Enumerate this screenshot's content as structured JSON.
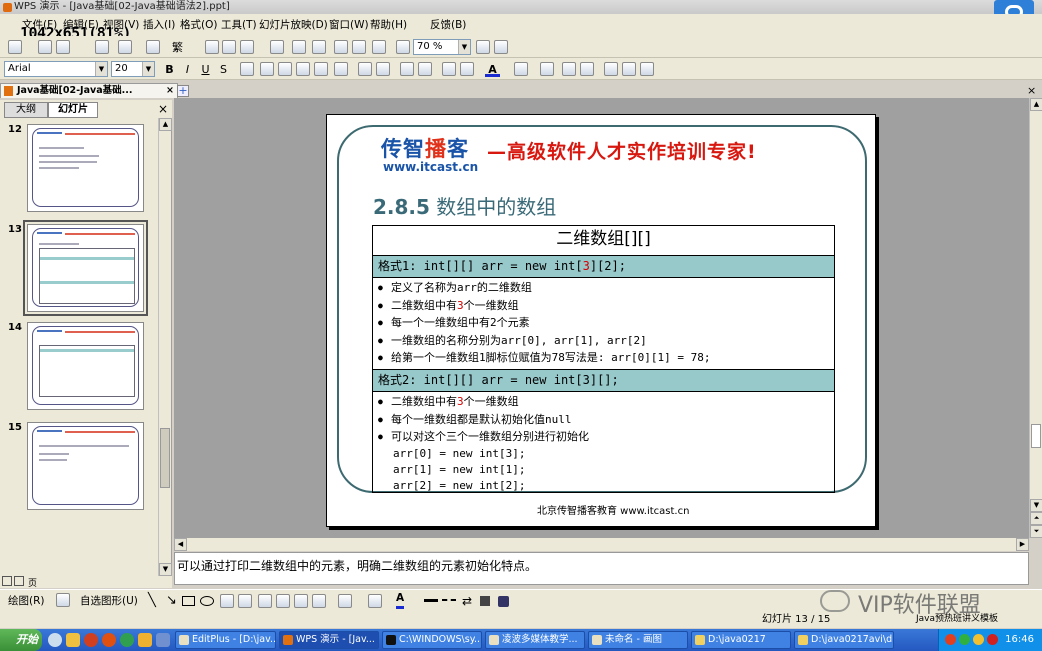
{
  "window": {
    "title": "WPS 演示 - [Java基础[02-Java基础语法2].ppt]",
    "zoom_overlay": "1042x651(81%)"
  },
  "menu": [
    "文件(F)",
    "编辑(E)",
    "视图(V)",
    "插入(I)",
    "格式(O)",
    "工具(T)",
    "幻灯片放映(D)",
    "窗口(W)",
    "帮助(H)",
    "反馈(B)"
  ],
  "toolbar": {
    "zoom_value": "70 %",
    "font_name": "Arial",
    "font_size": "20",
    "bold": "B",
    "italic": "I",
    "underline": "U",
    "shadow": "S",
    "trad": "繁"
  },
  "doc_tab": "Java基础[02-Java基础...",
  "panel_tabs": {
    "outline": "大纲",
    "slides": "幻灯片"
  },
  "thumbnails": [
    "12",
    "13",
    "14",
    "15"
  ],
  "slide": {
    "logo_text_a": "传智",
    "logo_text_b": "播",
    "logo_text_c": "客",
    "logo_url": "www.itcast.cn",
    "slogan": "—高级软件人才实作培训专家!",
    "heading_num": "2.8.5",
    "heading_text": " 数组中的数组",
    "table_title": "二维数组[][]",
    "format1_pre": "格式1: int[][] arr = new int[",
    "format1_red": "3",
    "format1_post": "][2];",
    "list1": [
      {
        "pre": "定义了名称为arr的二维数组",
        "red": "",
        "post": ""
      },
      {
        "pre": "二维数组中有",
        "red": "3",
        "post": "个一维数组"
      },
      {
        "pre": "每一个一维数组中有2个元素",
        "red": "",
        "post": ""
      },
      {
        "pre": "一维数组的名称分别为arr[0], arr[1], arr[2]",
        "red": "",
        "post": ""
      },
      {
        "pre": "给第一个一维数组1脚标位赋值为78写法是: arr[0][1] = 78;",
        "red": "",
        "post": ""
      }
    ],
    "format2": "格式2: int[][] arr = new int[3][];",
    "list2": [
      {
        "pre": "二维数组中有",
        "red": "3",
        "post": "个一维数组"
      },
      {
        "pre": "每个一维数组都是默认初始化值null",
        "red": "",
        "post": ""
      },
      {
        "pre": "可以对这个三个一维数组分别进行初始化",
        "red": "",
        "post": ""
      }
    ],
    "code": [
      "arr[0] = new int[3];",
      "arr[1] = new int[1];",
      "arr[2] = new int[2];"
    ],
    "footer": "北京传智播客教育 www.itcast.cn"
  },
  "notes": "可以通过打印二维数组中的元素，明确二维数组的元素初始化特点。",
  "drawbar": {
    "draw": "绘图(R)",
    "autoshape": "自选图形(U)"
  },
  "status": {
    "slide_counter": "幻灯片 13 / 15",
    "template": "Java预热班讲义模板"
  },
  "taskbar": {
    "start": "开始",
    "tasks": [
      "EditPlus - [D:\\jav...",
      "WPS 演示 - [Jav...",
      "C:\\WINDOWS\\sy...",
      "凌波多媒体教学...",
      "未命名 - 画图",
      "D:\\java0217",
      "D:\\java0217avi\\d..."
    ],
    "clock": "16:46"
  },
  "watermark": "VIP软件联盟"
}
